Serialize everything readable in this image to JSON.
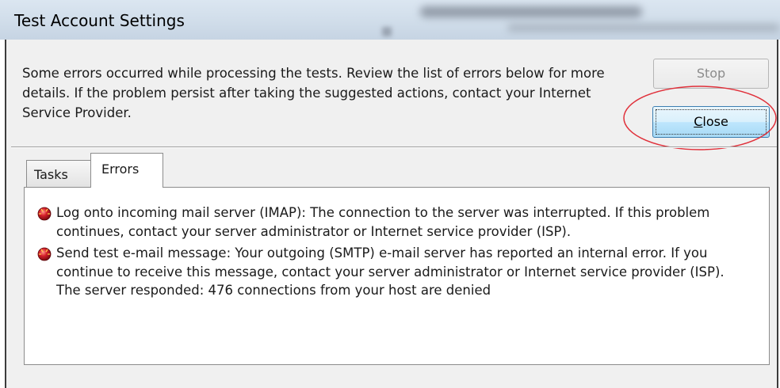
{
  "window": {
    "title": "Test Account Settings"
  },
  "dialog": {
    "message": "Some errors occurred while processing the tests. Review the list of errors below for more details. If the problem persist after taking the suggested actions, contact your Internet Service Provider.",
    "buttons": {
      "stop_label": "Stop",
      "close_label": "Close"
    },
    "tabs": [
      {
        "label": "Tasks",
        "selected": false
      },
      {
        "label": "Errors",
        "selected": true
      }
    ],
    "errors": [
      {
        "icon": "error-icon",
        "text": "Log onto incoming mail server (IMAP): The connection to the server was interrupted. If this problem continues, contact your server administrator or Internet service provider (ISP)."
      },
      {
        "icon": "error-icon",
        "text": "Send test e-mail message: Your outgoing (SMTP) e-mail server has reported an internal error. If you continue to receive this message, contact your server administrator or Internet service provider (ISP).  The server responded: 476 connections from your host are denied"
      }
    ]
  },
  "colors": {
    "annotation_ellipse": "#e0303a",
    "error_icon": "#c0141c",
    "close_button_focus": "#3c7fb1"
  }
}
